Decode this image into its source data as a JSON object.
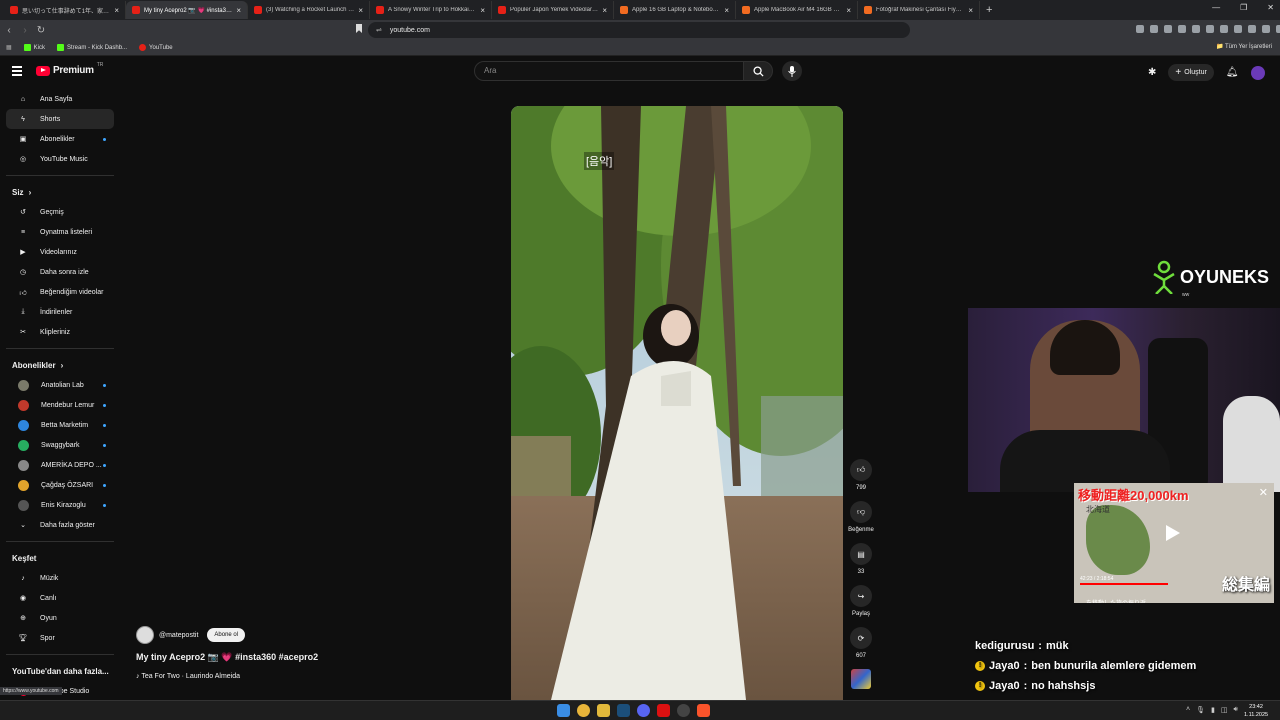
{
  "browser": {
    "tabs": [
      {
        "title": "思い切って仕事辞めて1年、家で日本旅…",
        "active": false,
        "favicon": "youtube"
      },
      {
        "title": "My tiny Acepro2 📷 💗 #insta3…",
        "active": true,
        "favicon": "youtube"
      },
      {
        "title": "(3) Watching a Rocket Launch at Sp…",
        "active": false,
        "favicon": "youtube"
      },
      {
        "title": "A Snowy Winter Trip to Hokkaido | …",
        "active": false,
        "favicon": "youtube"
      },
      {
        "title": "Popüler Japon Yemek Videoları Top …",
        "active": false,
        "favicon": "youtube"
      },
      {
        "title": "Apple 16 GB Laptop & Notebook ve…",
        "active": false,
        "favicon": "hb"
      },
      {
        "title": "Apple MacBook Air M4 16GB 256GB…",
        "active": false,
        "favicon": "hb"
      },
      {
        "title": "Fotoğraf Makinesi Çantası Fiyatları, …",
        "active": false,
        "favicon": "hb"
      }
    ],
    "url": "youtube.com",
    "bookmarks": [
      {
        "label": "Kick",
        "icon": "kick"
      },
      {
        "label": "Stream - Kick Dashb...",
        "icon": "kick"
      },
      {
        "label": "YouTube",
        "icon": "youtube"
      }
    ],
    "all_bookmarks": "Tüm Yer İşaretleri",
    "status_url": "https://www.youtube.com"
  },
  "youtube": {
    "logo_text": "Premium",
    "logo_tr": "TR",
    "search_placeholder": "Ara",
    "create_label": "Oluştur",
    "sidebar": {
      "main": [
        {
          "label": "Ana Sayfa",
          "icon": "home-icon",
          "active": false,
          "dot": false
        },
        {
          "label": "Shorts",
          "icon": "shorts-icon",
          "active": true,
          "dot": false
        },
        {
          "label": "Abonelikler",
          "icon": "subscriptions-icon",
          "active": false,
          "dot": true
        },
        {
          "label": "YouTube Music",
          "icon": "music-icon",
          "active": false,
          "dot": false
        }
      ],
      "you_header": "Siz",
      "you": [
        {
          "label": "Geçmiş",
          "icon": "history-icon"
        },
        {
          "label": "Oynatma listeleri",
          "icon": "playlist-icon"
        },
        {
          "label": "Videolarınız",
          "icon": "your-videos-icon"
        },
        {
          "label": "Daha sonra izle",
          "icon": "watch-later-icon"
        },
        {
          "label": "Beğendiğim videolar",
          "icon": "liked-icon"
        },
        {
          "label": "İndirilenler",
          "icon": "download-icon"
        },
        {
          "label": "Klipleriniz",
          "icon": "clips-icon"
        }
      ],
      "subs_header": "Abonelikler",
      "subs": [
        {
          "label": "Anatolian Lab",
          "color": "#7a7a6a"
        },
        {
          "label": "Mendebur Lemur",
          "color": "#c0392b"
        },
        {
          "label": "Betta Marketim",
          "color": "#2e86de"
        },
        {
          "label": "Swaggybark",
          "color": "#27ae60"
        },
        {
          "label": "AMERİKA DEPO ...",
          "color": "#888888"
        },
        {
          "label": "Çağdaş ÖZSARI",
          "color": "#e1a32b"
        },
        {
          "label": "Enis Kirazoglu",
          "color": "#555555"
        }
      ],
      "more_label": "Daha fazla göster",
      "explore_header": "Keşfet",
      "explore": [
        {
          "label": "Müzik",
          "icon": "music-note-icon"
        },
        {
          "label": "Canlı",
          "icon": "live-icon"
        },
        {
          "label": "Oyun",
          "icon": "gaming-icon"
        },
        {
          "label": "Spor",
          "icon": "trophy-icon"
        }
      ],
      "more_from_header": "YouTube'dan daha fazla...",
      "studio_label": "YouTube Studio"
    },
    "short": {
      "subtitle": "[음악]",
      "channel": "@matepostit",
      "subscribe_label": "Abone ol",
      "title": "My tiny Acepro2 📷 💗 #insta360 #acepro2",
      "music": "♪ Tea For Two · Laurindo Almeida",
      "likes": "799",
      "dislike_label": "Beğenme",
      "comments": "33",
      "share_label": "Paylaş",
      "remix": "607"
    }
  },
  "stream_overlay": {
    "brand": "OYUNEKS",
    "brand_sub": "ww",
    "mini_player": {
      "headline": "移動距離20,000km",
      "sub": "北海道",
      "big_text": "総集編",
      "time": "42:23 / 2:18:54",
      "title": "…を移動した旅の振り返…",
      "continue": "İzlemeye devam edin"
    },
    "chat": [
      {
        "user": "kedigurusu",
        "message": "mük",
        "badge": false
      },
      {
        "user": "Jaya0",
        "message": "ben bunurila alemlere gidemem",
        "badge": true
      },
      {
        "user": "Jaya0",
        "message": "no hahshsjs",
        "badge": true
      }
    ]
  },
  "taskbar": {
    "time": "23:42",
    "date": "1.11.2025",
    "apps": [
      "windows",
      "chrome",
      "files",
      "steam",
      "discord",
      "opera",
      "obs",
      "brave"
    ]
  }
}
